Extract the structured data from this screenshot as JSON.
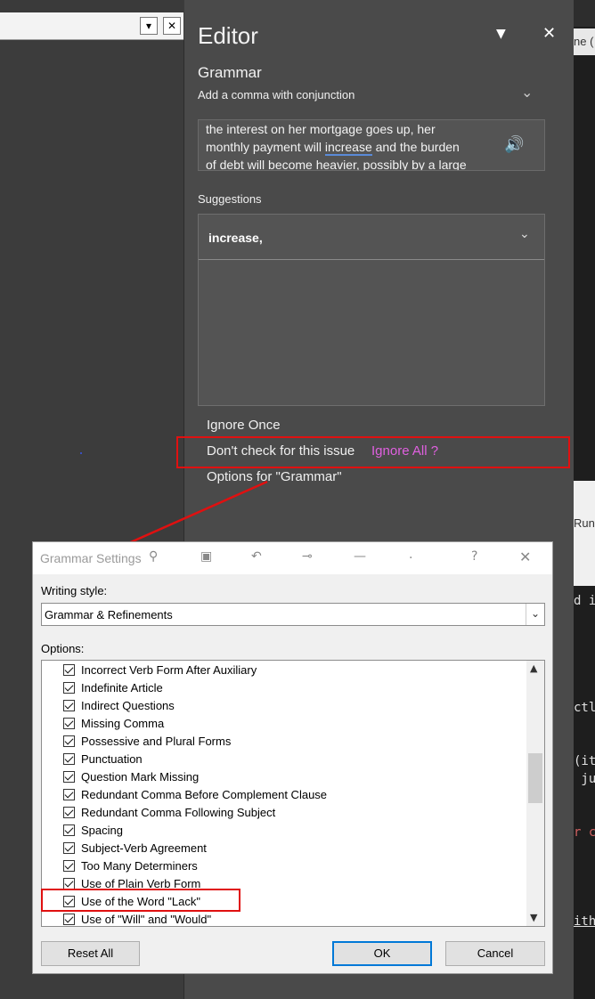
{
  "editor": {
    "title": "Editor",
    "category": "Grammar",
    "issue": "Add a comma with conjunction",
    "context_line1": "the interest on her mortgage goes up, her",
    "context_line2_pre": "monthly payment will ",
    "context_line2_word": "increase",
    "context_line2_post": " and the burden",
    "context_line3": "of debt will become heavier, possibly by a large",
    "suggestions_label": "Suggestions",
    "suggestion": "increase,",
    "ignore_once": "Ignore Once",
    "dont_check": "Don't check for this issue",
    "ignore_all_note": "Ignore All ?",
    "options_for": "Options for \"Grammar\""
  },
  "dialog": {
    "title": "Grammar Settings",
    "writing_style_label": "Writing style:",
    "writing_style_value": "Grammar & Refinements",
    "options_label": "Options:",
    "options": [
      "Incorrect Verb Form After Auxiliary",
      "Indefinite Article",
      "Indirect Questions",
      "Missing Comma",
      "Possessive and Plural Forms",
      "Punctuation",
      "Question Mark Missing",
      "Redundant Comma Before Complement Clause",
      "Redundant Comma Following Subject",
      "Spacing",
      "Subject-Verb Agreement",
      "Too Many Determiners",
      "Use of Plain Verb Form",
      "Use of the Word \"Lack\"",
      "Use of \"Will\" and \"Would\""
    ],
    "reset_label": "Reset All",
    "ok_label": "OK",
    "cancel_label": "Cancel",
    "help_glyph": "?",
    "close_glyph": "✕"
  },
  "background": {
    "code_fragments": [
      "d i",
      "ctl",
      "(it",
      " ju",
      "r c",
      "ith"
    ],
    "run_label": "Run",
    "tab_fragment": "ne ("
  },
  "colors": {
    "highlight_red": "#e01010",
    "annotation_pink": "#e060e0",
    "editor_bg": "#4a4a4a"
  }
}
